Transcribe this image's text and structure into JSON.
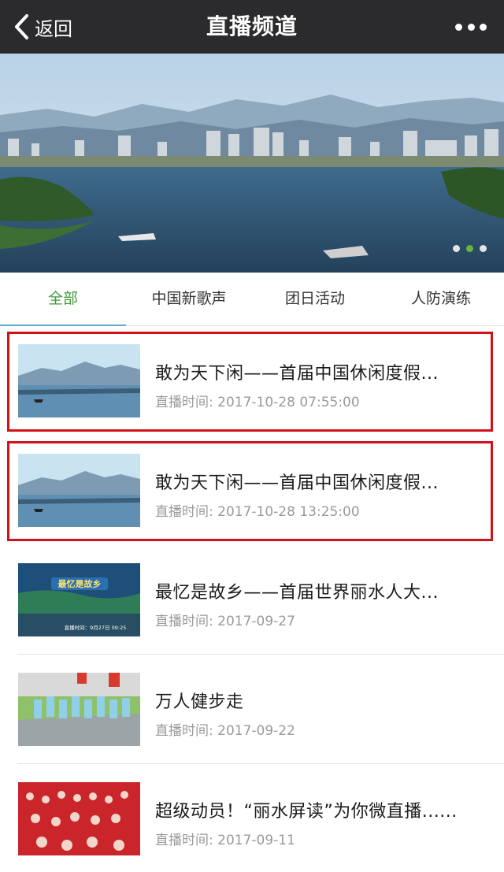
{
  "header": {
    "back_label": "返回",
    "title": "直播频道",
    "back_icon": "chevron-left-icon",
    "more_icon": "more-dots-icon"
  },
  "banner": {
    "slide_count": 3,
    "active_index": 1,
    "active_dot_color": "#6db33f"
  },
  "tabs": [
    {
      "label": "全部",
      "active": true
    },
    {
      "label": "中国新歌声",
      "active": false
    },
    {
      "label": "团日活动",
      "active": false
    },
    {
      "label": "人防演练",
      "active": false
    }
  ],
  "items": [
    {
      "title": "敢为天下闲——首届中国休闲度假...",
      "time": "直播时间: 2017-10-28 07:55:00",
      "highlighted": true
    },
    {
      "title": "敢为天下闲——首届中国休闲度假...",
      "time": "直播时间: 2017-10-28 13:25:00",
      "highlighted": true
    },
    {
      "title": "最忆是故乡——首届世界丽水人大...",
      "time": "直播时间: 2017-09-27",
      "highlighted": false,
      "thumb_text": {
        "heading": "最忆是故乡",
        "date": "直播时间：9月27日 09:25"
      }
    },
    {
      "title": "万人健步走",
      "time": "直播时间: 2017-09-22",
      "highlighted": false
    },
    {
      "title": "超级动员！“丽水屏读”为你微直播......",
      "time": "直播时间: 2017-09-11",
      "highlighted": false
    }
  ],
  "colors": {
    "header_bg": "#2b2b2d",
    "tab_active": "#3d9a38",
    "highlight_border": "#d0121b"
  }
}
